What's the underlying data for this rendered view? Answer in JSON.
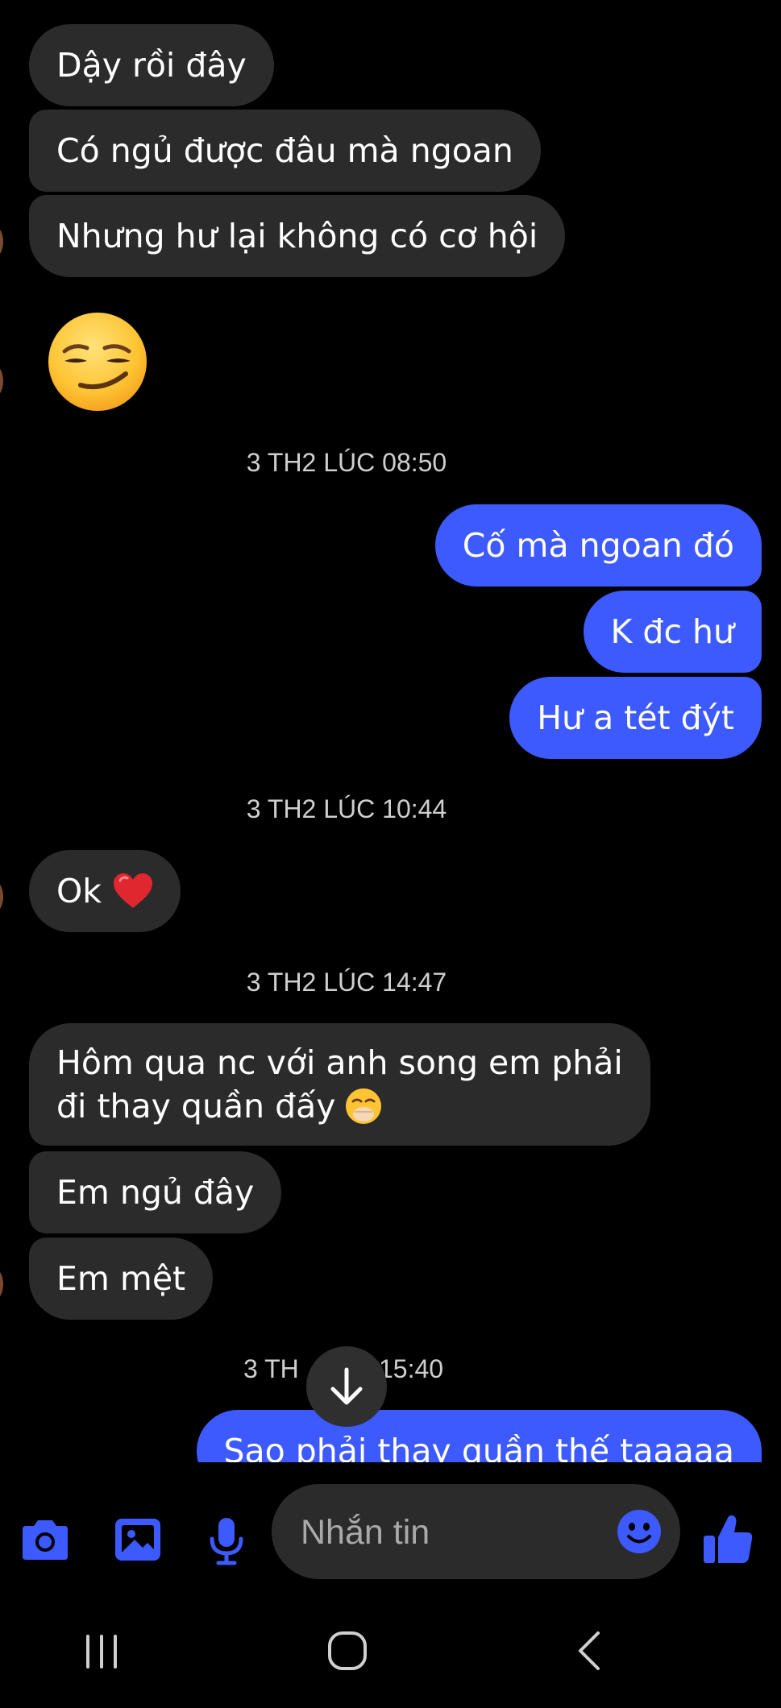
{
  "messages": {
    "m1": "Dậy rồi đây",
    "m2": "Có ngủ được đâu mà ngoan",
    "m3": "Nhưng hư lại không có cơ hội",
    "ts1": "3 TH2 LÚC 08:50",
    "o1": "Cố mà ngoan đó",
    "o2": "K đc hư",
    "o3": "Hư a tét đýt",
    "ts2": "3 TH2 LÚC 10:44",
    "m4": "Ok",
    "ts3": "3 TH2 LÚC 14:47",
    "m5_line1": "Hôm qua nc với anh song em phải",
    "m5_line2": "đi thay quần đấy",
    "m6": "Em ngủ đây",
    "m7": "Em mệt",
    "ts4_left": "3 TH",
    "ts4_right": "15:40",
    "o4": "Sao phải thay quần thế taaaaa"
  },
  "composer": {
    "placeholder": "Nhắn tin"
  },
  "icons": {
    "accent": "#3d5afe",
    "camera": "camera-icon",
    "gallery": "gallery-icon",
    "mic": "microphone-icon",
    "emoji": "emoji-icon",
    "like": "thumbs-up-icon",
    "scroll": "arrow-down-icon"
  },
  "colors": {
    "incoming_bubble": "#2b2b2b",
    "outgoing_bubble": "#3d5afe",
    "background": "#000000"
  }
}
